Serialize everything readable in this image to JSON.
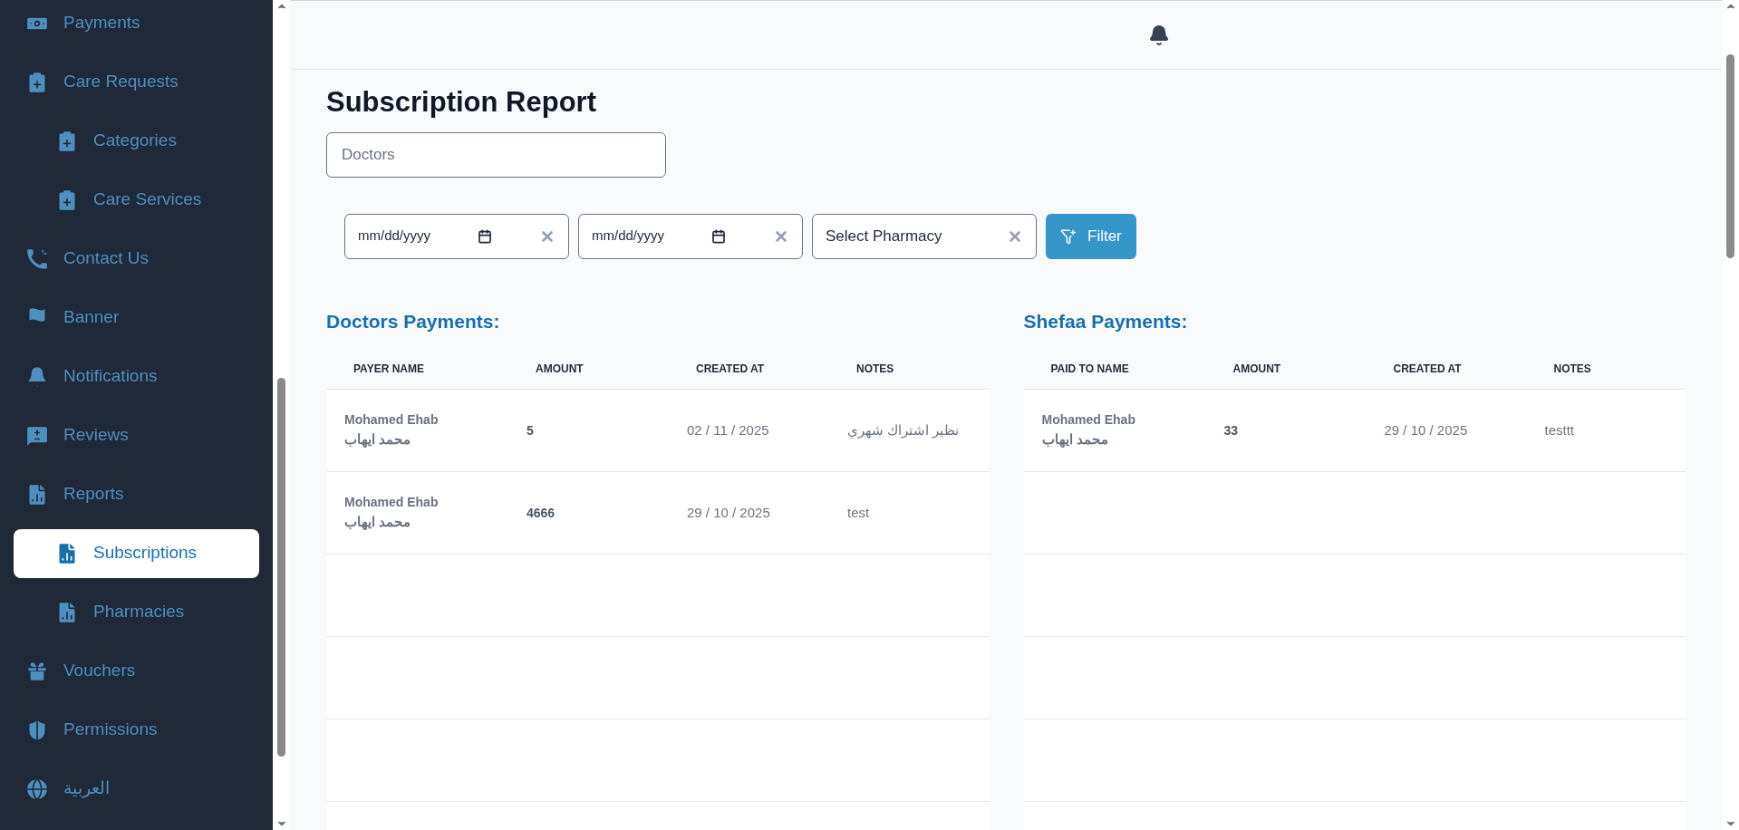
{
  "sidebar": {
    "items": [
      {
        "label": "Payments",
        "selected": false
      },
      {
        "label": "Care Requests",
        "selected": false,
        "children": [
          {
            "label": "Categories",
            "selected": false
          },
          {
            "label": "Care Services",
            "selected": false
          }
        ]
      },
      {
        "label": "Contact Us",
        "selected": false
      },
      {
        "label": "Banner",
        "selected": false
      },
      {
        "label": "Notifications",
        "selected": false
      },
      {
        "label": "Reviews",
        "selected": false
      },
      {
        "label": "Reports",
        "selected": false,
        "children": [
          {
            "label": "Subscriptions",
            "selected": true
          },
          {
            "label": "Pharmacies",
            "selected": false
          }
        ]
      },
      {
        "label": "Vouchers",
        "selected": false
      },
      {
        "label": "Permissions",
        "selected": false
      },
      {
        "label": "العربية",
        "selected": false
      }
    ]
  },
  "page": {
    "title": "Subscription Report",
    "type_field": {
      "placeholder": "Doctors"
    },
    "filters": {
      "date_from": {
        "placeholder": "mm/dd/yyyy"
      },
      "date_to": {
        "placeholder": "mm/dd/yyyy"
      },
      "pharmacy": {
        "placeholder": "Select Pharmacy"
      },
      "button": "Filter"
    }
  },
  "tables": [
    {
      "title": "Doctors Payments:",
      "columns": [
        "PAYER NAME",
        "AMOUNT",
        "CREATED AT",
        "NOTES"
      ],
      "rows": [
        {
          "name": "Mohamed Ehab",
          "name_ar": "محمد ايهاب",
          "amount": "5",
          "created_at": "02 / 11 / 2025",
          "notes": "نظير اشتراك شهري"
        },
        {
          "name": "Mohamed Ehab",
          "name_ar": "محمد ايهاب",
          "amount": "4666",
          "created_at": "29 / 10 / 2025",
          "notes": "test"
        }
      ]
    },
    {
      "title": "Shefaa Payments:",
      "columns": [
        "PAID TO NAME",
        "AMOUNT",
        "CREATED AT",
        "NOTES"
      ],
      "rows": [
        {
          "name": "Mohamed Ehab",
          "name_ar": "محمد ايهاب",
          "amount": "33",
          "created_at": "29 / 10 / 2025",
          "notes": "testtt"
        }
      ]
    }
  ]
}
